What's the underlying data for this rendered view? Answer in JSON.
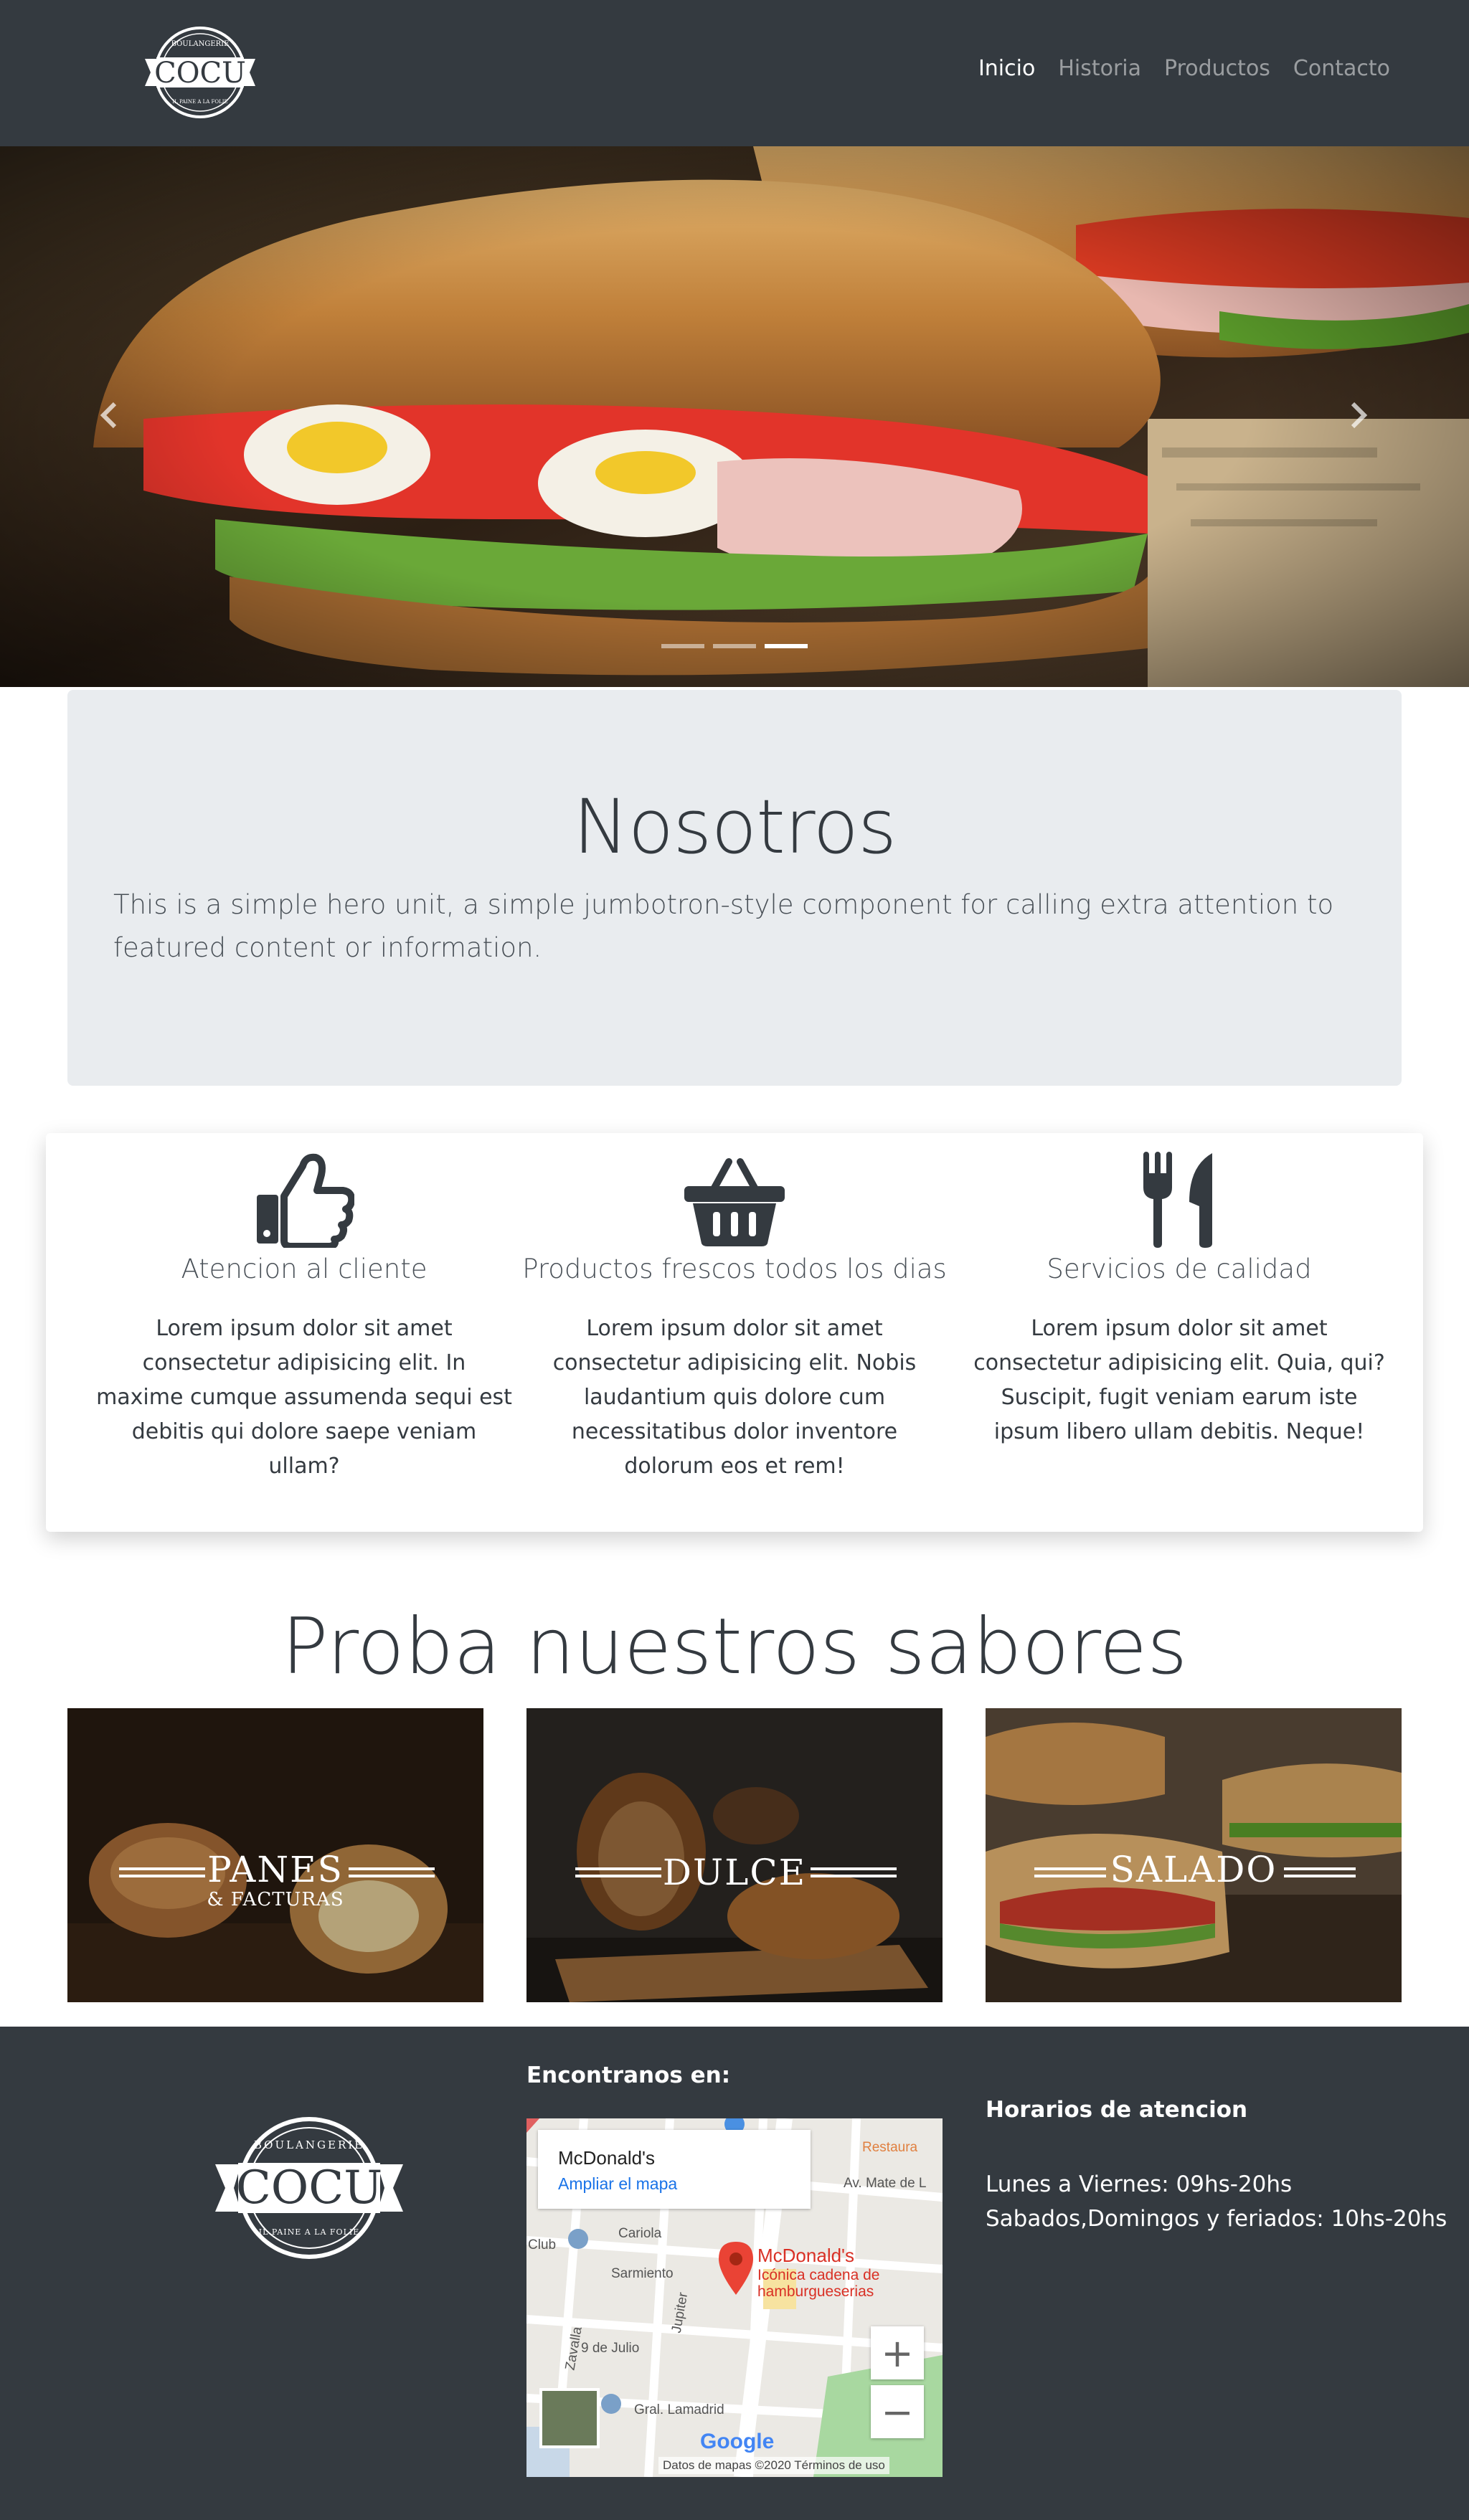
{
  "brand": {
    "logo_top": "BOULANGERIE",
    "logo_name": "COCU",
    "logo_bottom": "IL PAINE A LA FOLIE"
  },
  "nav": {
    "links": [
      {
        "label": "Inicio",
        "active": true
      },
      {
        "label": "Historia",
        "active": false
      },
      {
        "label": "Productos",
        "active": false
      },
      {
        "label": "Contacto",
        "active": false
      }
    ]
  },
  "carousel": {
    "slide_count": 3,
    "active_index": 2
  },
  "jumbotron": {
    "title": "Nosotros",
    "lead": "This is a simple hero unit, a simple jumbotron-style component for calling extra attention to featured content or information."
  },
  "features": [
    {
      "icon": "thumbs-up-icon",
      "title": "Atencion al cliente",
      "text": "Lorem ipsum dolor sit amet consectetur adipisicing elit. In maxime cumque assumenda sequi est debitis qui dolore saepe veniam ullam?"
    },
    {
      "icon": "basket-icon",
      "title": "Productos frescos todos los dias",
      "text": "Lorem ipsum dolor sit amet consectetur adipisicing elit. Nobis laudantium quis dolore cum necessitatibus dolor inventore dolorum eos et rem!"
    },
    {
      "icon": "utensils-icon",
      "title": "Servicios de calidad",
      "text": "Lorem ipsum dolor sit amet consectetur adipisicing elit. Quia, qui? Suscipit, fugit veniam earum iste ipsum libero ullam debitis. Neque!"
    }
  ],
  "sabores": {
    "title": "Proba nuestros sabores",
    "tiles": [
      {
        "label": "PANES",
        "sub": "& FACTURAS"
      },
      {
        "label": "DULCE",
        "sub": ""
      },
      {
        "label": "SALADO",
        "sub": ""
      }
    ]
  },
  "footer": {
    "find_us": "Encontranos en:",
    "hours_title": "Horarios de atencion",
    "hours": [
      "Lunes a Viernes: 09hs-20hs",
      "Sabados,Domingos y feriados: 10hs-20hs"
    ],
    "map": {
      "card_title": "McDonald's",
      "card_link": "Ampliar el mapa",
      "place_name": "McDonald's",
      "place_desc_1": "Icónica cadena de",
      "place_desc_2": "hamburgueserias",
      "zoom_in": "+",
      "zoom_out": "−",
      "attribution": "Datos de mapas ©2020   Términos de uso",
      "google": "Google",
      "streets": [
        "Cariola",
        "Sarmiento",
        "Jupiter",
        "9 de Julio",
        "Zavalla",
        "Gral. Lamadrid",
        "Av. Mate de L",
        "Restaura",
        "Club"
      ]
    }
  },
  "colors": {
    "navbar": "#343a40",
    "jumbotron": "#e9ecef",
    "footer": "#343a40"
  }
}
